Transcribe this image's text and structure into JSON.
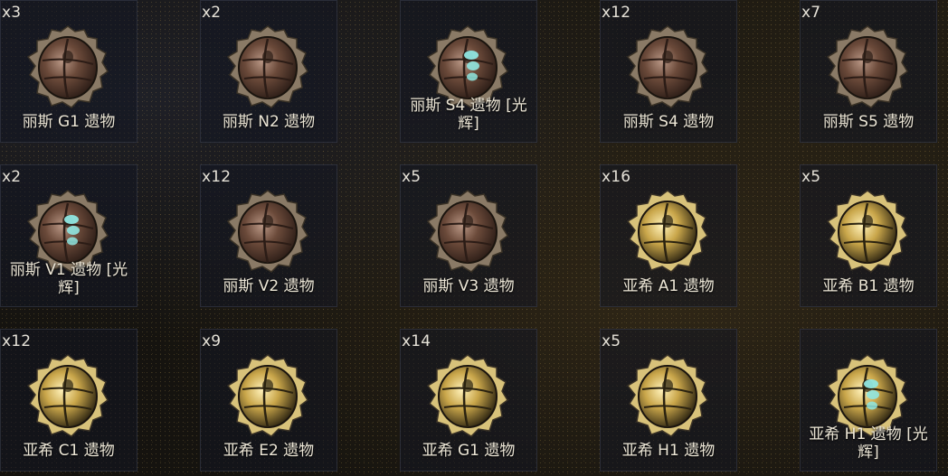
{
  "items": [
    {
      "count": "x3",
      "name": "丽斯 G1 遗物",
      "type": "bronze",
      "radiant": false
    },
    {
      "count": "x2",
      "name": "丽斯 N2 遗物",
      "type": "bronze",
      "radiant": false
    },
    {
      "count": "",
      "name": "丽斯 S4 遗物 [光辉]",
      "type": "bronze",
      "radiant": true
    },
    {
      "count": "x12",
      "name": "丽斯 S4 遗物",
      "type": "bronze",
      "radiant": false
    },
    {
      "count": "x7",
      "name": "丽斯 S5 遗物",
      "type": "bronze",
      "radiant": false
    },
    {
      "count": "x2",
      "name": "丽斯 V1 遗物 [光辉]",
      "type": "bronze",
      "radiant": true
    },
    {
      "count": "x12",
      "name": "丽斯 V2 遗物",
      "type": "bronze",
      "radiant": false
    },
    {
      "count": "x5",
      "name": "丽斯 V3 遗物",
      "type": "bronze",
      "radiant": false
    },
    {
      "count": "x16",
      "name": "亚希 A1 遗物",
      "type": "gold",
      "radiant": false
    },
    {
      "count": "x5",
      "name": "亚希 B1 遗物",
      "type": "gold",
      "radiant": false
    },
    {
      "count": "x12",
      "name": "亚希 C1 遗物",
      "type": "gold",
      "radiant": false
    },
    {
      "count": "x9",
      "name": "亚希 E2 遗物",
      "type": "gold",
      "radiant": false
    },
    {
      "count": "x14",
      "name": "亚希 G1 遗物",
      "type": "gold",
      "radiant": false
    },
    {
      "count": "x5",
      "name": "亚希 H1 遗物",
      "type": "gold",
      "radiant": false
    },
    {
      "count": "",
      "name": "亚希 H1 遗物 [光辉]",
      "type": "gold",
      "radiant": true
    }
  ],
  "colors": {
    "bronze_body": "#6b4a3a",
    "bronze_rim": "#8a7a66",
    "gold_body": "#c9a64a",
    "gold_rim": "#d8c27a",
    "radiant_glow": "#8fe6e0",
    "label_text": "#ece6d6",
    "count_text": "#e6e2d8"
  }
}
